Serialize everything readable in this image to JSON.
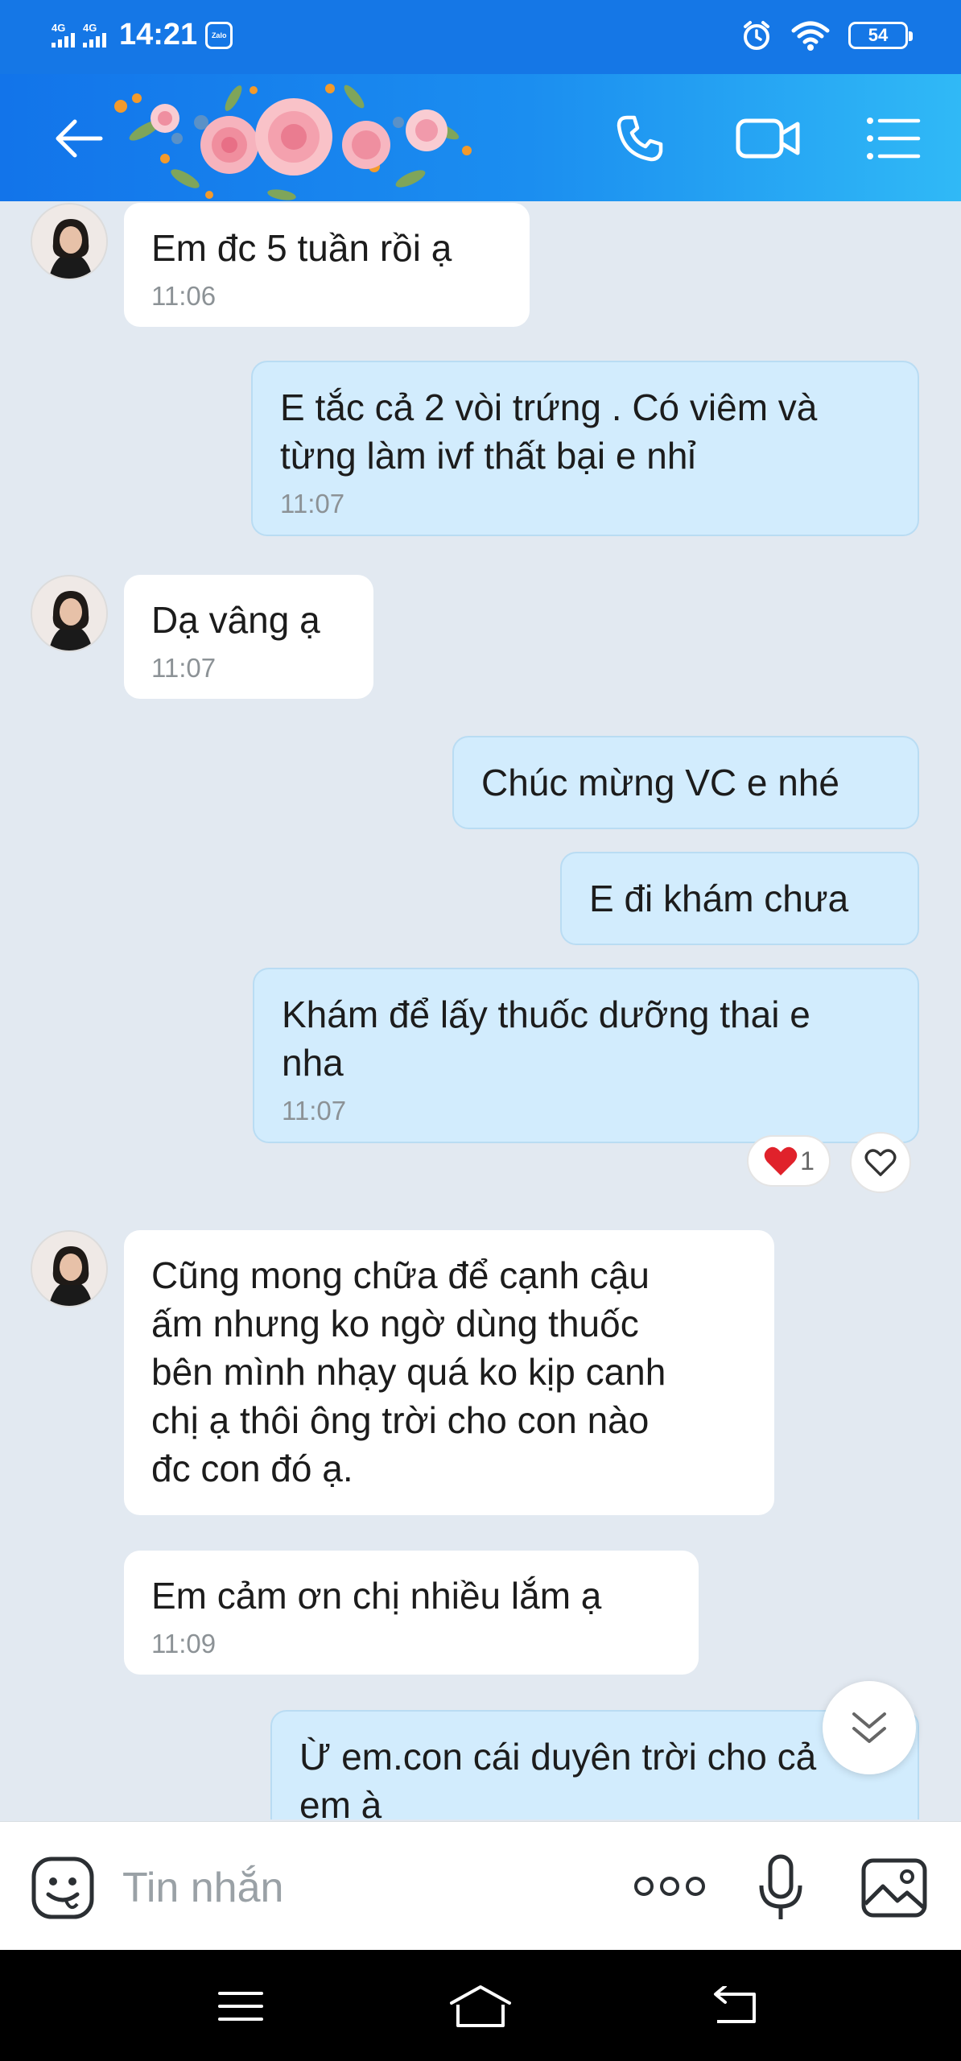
{
  "status_bar": {
    "time": "14:21",
    "network_1": "4G",
    "network_2": "4G",
    "zalo_mini": "Zalo",
    "battery": "54"
  },
  "header": {
    "back_icon": "back-arrow-icon",
    "call_icon": "phone-icon",
    "video_icon": "video-camera-icon",
    "menu_icon": "list-menu-icon"
  },
  "messages": [
    {
      "side": "in",
      "lines": [
        "Em đc 5 tuần rồi ạ"
      ],
      "time": "11:06"
    },
    {
      "side": "out",
      "lines": [
        "E tắc cả 2 vòi trứng . Có viêm và",
        "từng làm ivf thất bại e nhỉ"
      ],
      "time": "11:07"
    },
    {
      "side": "in",
      "lines": [
        "Dạ vâng ạ"
      ],
      "time": "11:07"
    },
    {
      "side": "out",
      "lines": [
        "Chúc mừng VC e nhé"
      ]
    },
    {
      "side": "out",
      "lines": [
        "E đi khám chưa"
      ]
    },
    {
      "side": "out",
      "lines": [
        "Khám để lấy thuốc dưỡng thai e",
        "nha"
      ],
      "time": "11:07"
    },
    {
      "side": "in",
      "lines": [
        "Cũng mong chữa để cạnh cậu",
        "ấm nhưng ko ngờ dùng thuốc",
        "bên mình nhạy quá ko kịp canh",
        "chị ạ thôi ông trời cho con nào",
        "đc con đó ạ."
      ]
    },
    {
      "side": "in",
      "lines": [
        "Em cảm ơn chị nhiều lắm ạ"
      ],
      "time": "11:09"
    },
    {
      "side": "out",
      "lines": [
        "Ừ em.con cái duyên trời cho cả",
        "em à"
      ]
    }
  ],
  "reaction": {
    "count": "1",
    "heart_color": "#e0222b"
  },
  "input_bar": {
    "placeholder": "Tin nhắn",
    "sticker_icon": "sticker-face-icon",
    "more_icon": "more-dots-icon",
    "mic_icon": "microphone-icon",
    "image_icon": "image-gallery-icon"
  },
  "colors": {
    "header": "#1577e6",
    "out_bubble": "#d2ecfd",
    "in_bubble": "#ffffff",
    "chat_bg": "#e2e9f1"
  }
}
